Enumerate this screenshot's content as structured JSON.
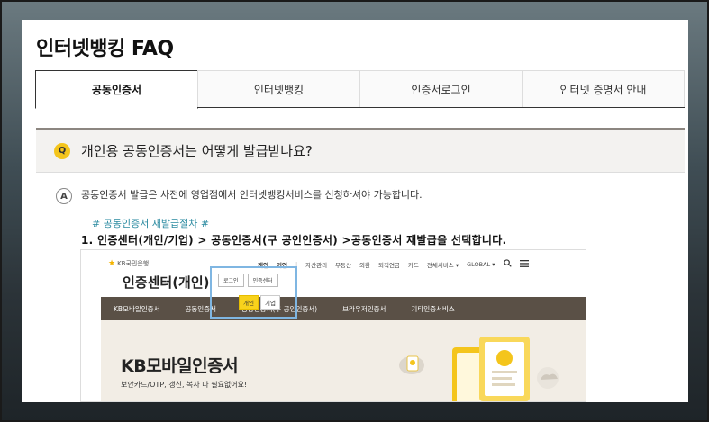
{
  "page": {
    "title": "인터넷뱅킹 FAQ"
  },
  "tabs": [
    {
      "label": "공동인증서",
      "active": true
    },
    {
      "label": "인터넷뱅킹",
      "active": false
    },
    {
      "label": "인증서로그인",
      "active": false
    },
    {
      "label": "인터넷 증명서 안내",
      "active": false
    }
  ],
  "faq": {
    "q_icon": "Q",
    "question": "개인용 공동인증서는 어떻게 발급받나요?",
    "a_icon": "A",
    "answer": "공동인증서 발급은 사전에 영업점에서 인터넷뱅킹서비스를 신청하셔야 가능합니다.",
    "step_link": "# 공동인증서 재발급절차 #",
    "step1": "1. 인증센터(개인/기업) > 공동인증서(구 공인인증서) >공동인증서 재발급을 선택합니다."
  },
  "embedded": {
    "logo": "KB국민은행",
    "title": "인증센터(개인)",
    "buttons": [
      "로그인",
      "인증센터"
    ],
    "util": [
      "개인",
      "기업",
      "자산관리",
      "부동산",
      "외환",
      "퇴직연금",
      "카드",
      "전체서비스 ▾",
      "GLOBAL ▾"
    ],
    "sub": [
      "개인",
      "기업"
    ],
    "nav": [
      "KB모바일인증서",
      "공동인증서",
      "공동인증서(구 공인인증서)",
      "브라우저인증서",
      "기타인증서비스"
    ],
    "banner_title": "KB모바일인증서",
    "banner_sub": "보안카드/OTP, 갱신, 복사 다 필요없어요!",
    "colors": {
      "nav": "#5a5046",
      "accent": "#f8d21c",
      "highlight": "#7fb6e2"
    }
  }
}
